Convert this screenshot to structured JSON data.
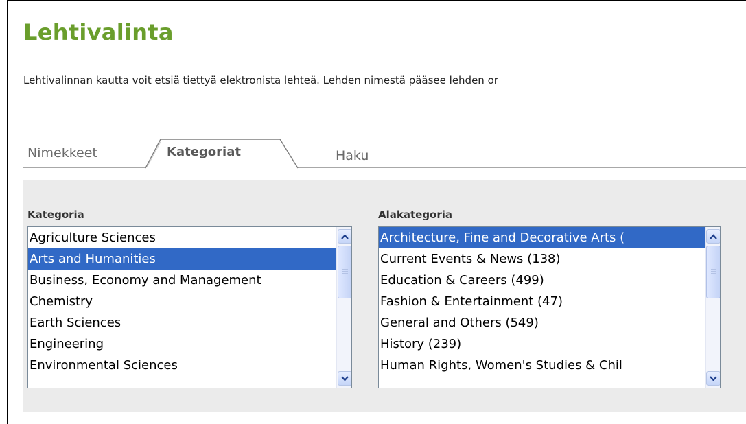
{
  "page": {
    "title": "Lehtivalinta",
    "intro": "Lehtivalinnan kautta voit etsiä tiettyä elektronista lehteä. Lehden nimestä pääsee lehden or"
  },
  "tabs": {
    "names": "Nimekkeet",
    "categories": "Kategoriat",
    "search": "Haku",
    "active": "Kategoriat"
  },
  "category_list": {
    "label": "Kategoria",
    "items": [
      "Agriculture Sciences",
      "Arts and Humanities",
      "Business, Economy and Management",
      "Chemistry",
      "Earth Sciences",
      "Engineering",
      "Environmental Sciences"
    ],
    "selected": "Arts and Humanities"
  },
  "subcategory_list": {
    "label": "Alakategoria",
    "items": [
      "Architecture, Fine and Decorative Arts (",
      "Current Events & News (138)",
      "Education & Careers (499)",
      "Fashion & Entertainment (47)",
      "General and Others (549)",
      "History (239)",
      "Human Rights, Women's Studies & Chil"
    ],
    "selected": "Architecture, Fine and Decorative Arts ("
  },
  "colors": {
    "title": "#6a9e2c",
    "selection": "#3169c6",
    "panel": "#ebebeb"
  },
  "icons": {
    "scroll_up": "chevron-up-icon",
    "scroll_down": "chevron-down-icon"
  }
}
